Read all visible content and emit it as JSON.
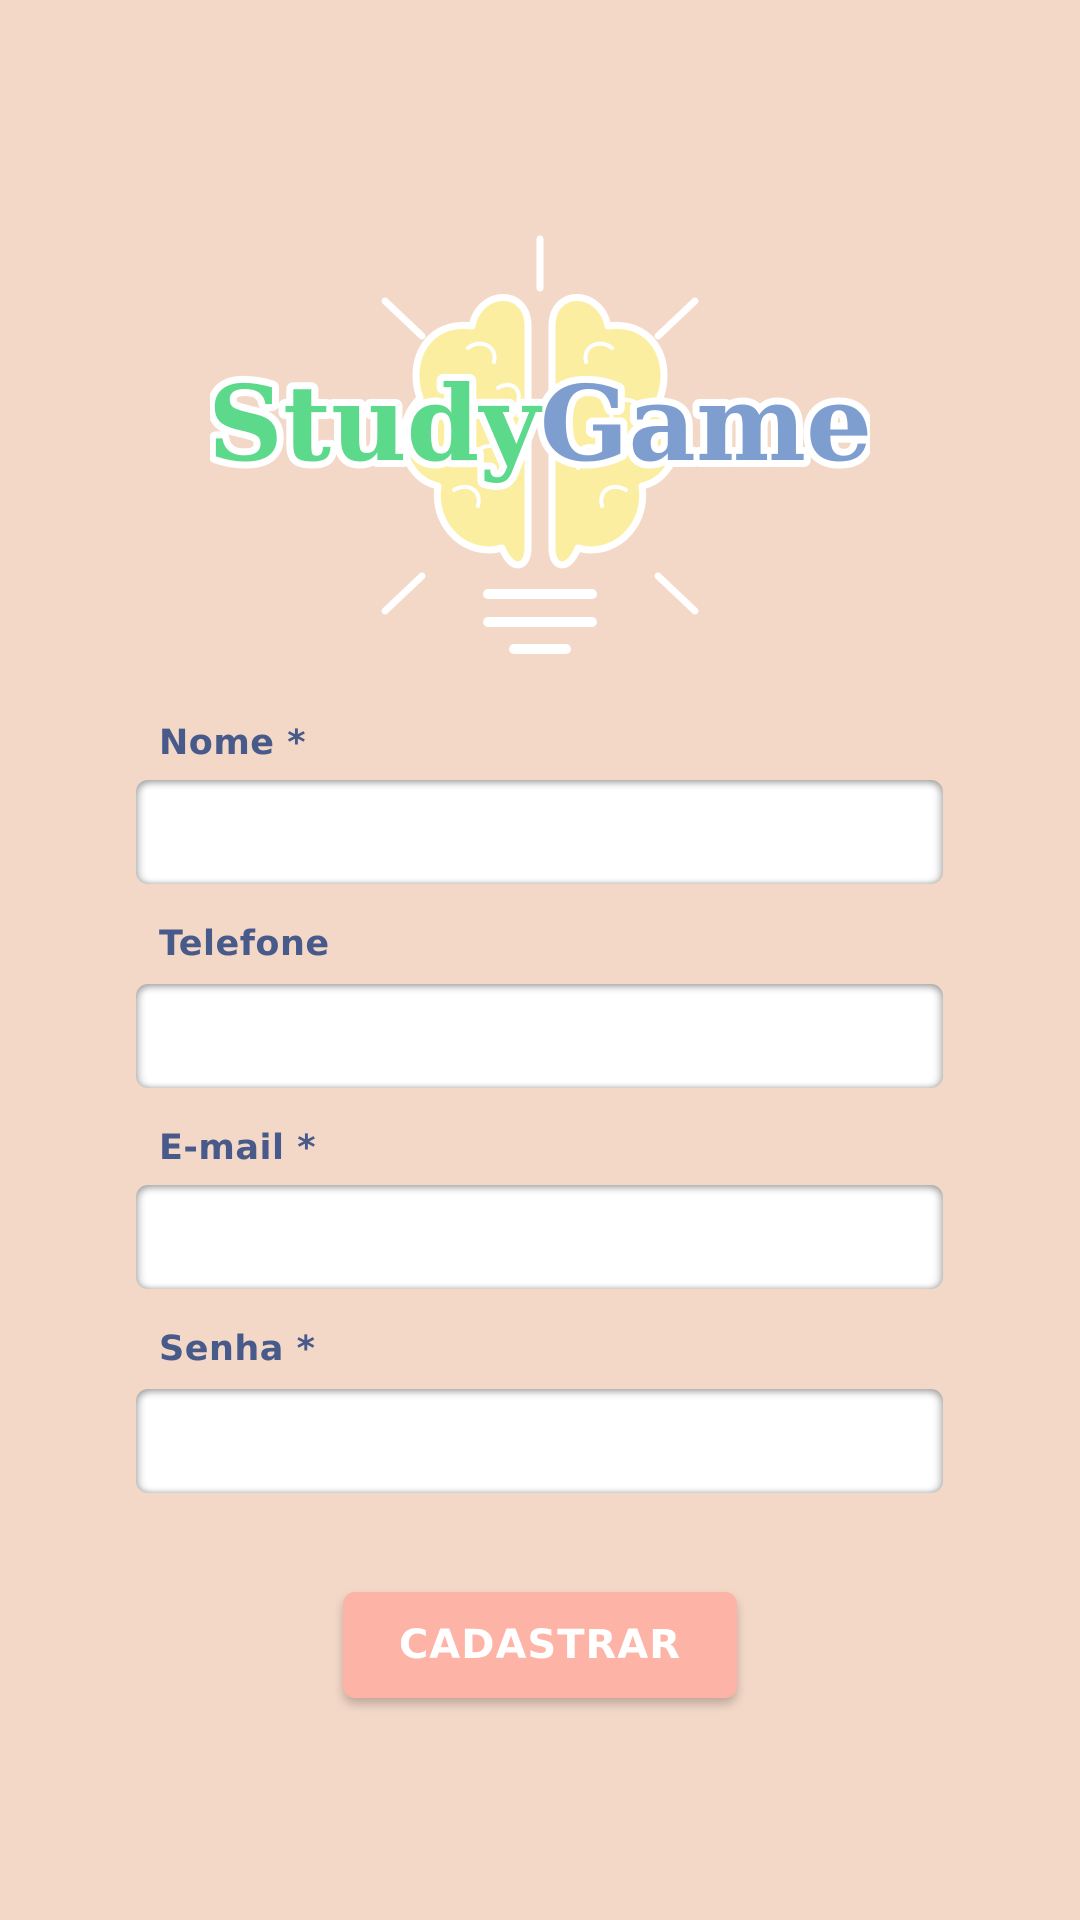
{
  "logo": {
    "part1": "Study",
    "part2": "Game",
    "colors": {
      "study": "#5dd98c",
      "game": "#7f9ed0",
      "brain": "#fbeea0",
      "rays": "#ffffff"
    },
    "icon": "lightbulb-brain-icon"
  },
  "form": {
    "fields": [
      {
        "label": "Nome *",
        "value": "",
        "placeholder": ""
      },
      {
        "label": "Telefone",
        "value": "",
        "placeholder": ""
      },
      {
        "label": "E-mail *",
        "value": "",
        "placeholder": ""
      },
      {
        "label": "Senha *",
        "value": "",
        "placeholder": ""
      }
    ],
    "submit_label": "CADASTRAR"
  },
  "colors": {
    "background": "#f3d8c8",
    "label": "#485a8a",
    "button": "#fdb4a6",
    "button_text": "#ffffff",
    "input": "#ffffff"
  }
}
